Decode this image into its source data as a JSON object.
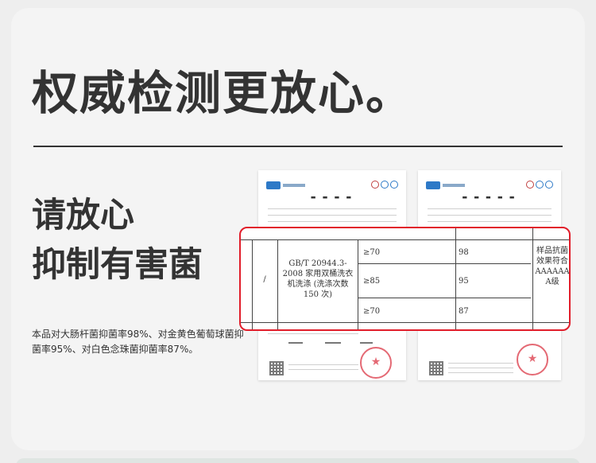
{
  "headline": "权威检测更放心。",
  "subtitle_line1": "请放心",
  "subtitle_line2": "抑制有害菌",
  "description": "本品对大肠杆菌抑菌率98%、对金黄色葡萄球菌抑菌率95%、对白色念珠菌抑菌率87%。",
  "zoom_table": {
    "dash": "/",
    "standard": "GB/T 20944.3-2008 家用双桶洗衣机洗涤 (洗涤次数 150 次)",
    "rows": [
      {
        "requirement": "≥70",
        "result": "98"
      },
      {
        "requirement": "≥85",
        "result": "95"
      },
      {
        "requirement": "≥70",
        "result": "87"
      }
    ],
    "conclusion": "样品抗菌效果符合AAAAAAA级"
  },
  "colors": {
    "highlight_border": "#e11d2a",
    "seal": "#e0505c",
    "text": "#333333"
  }
}
